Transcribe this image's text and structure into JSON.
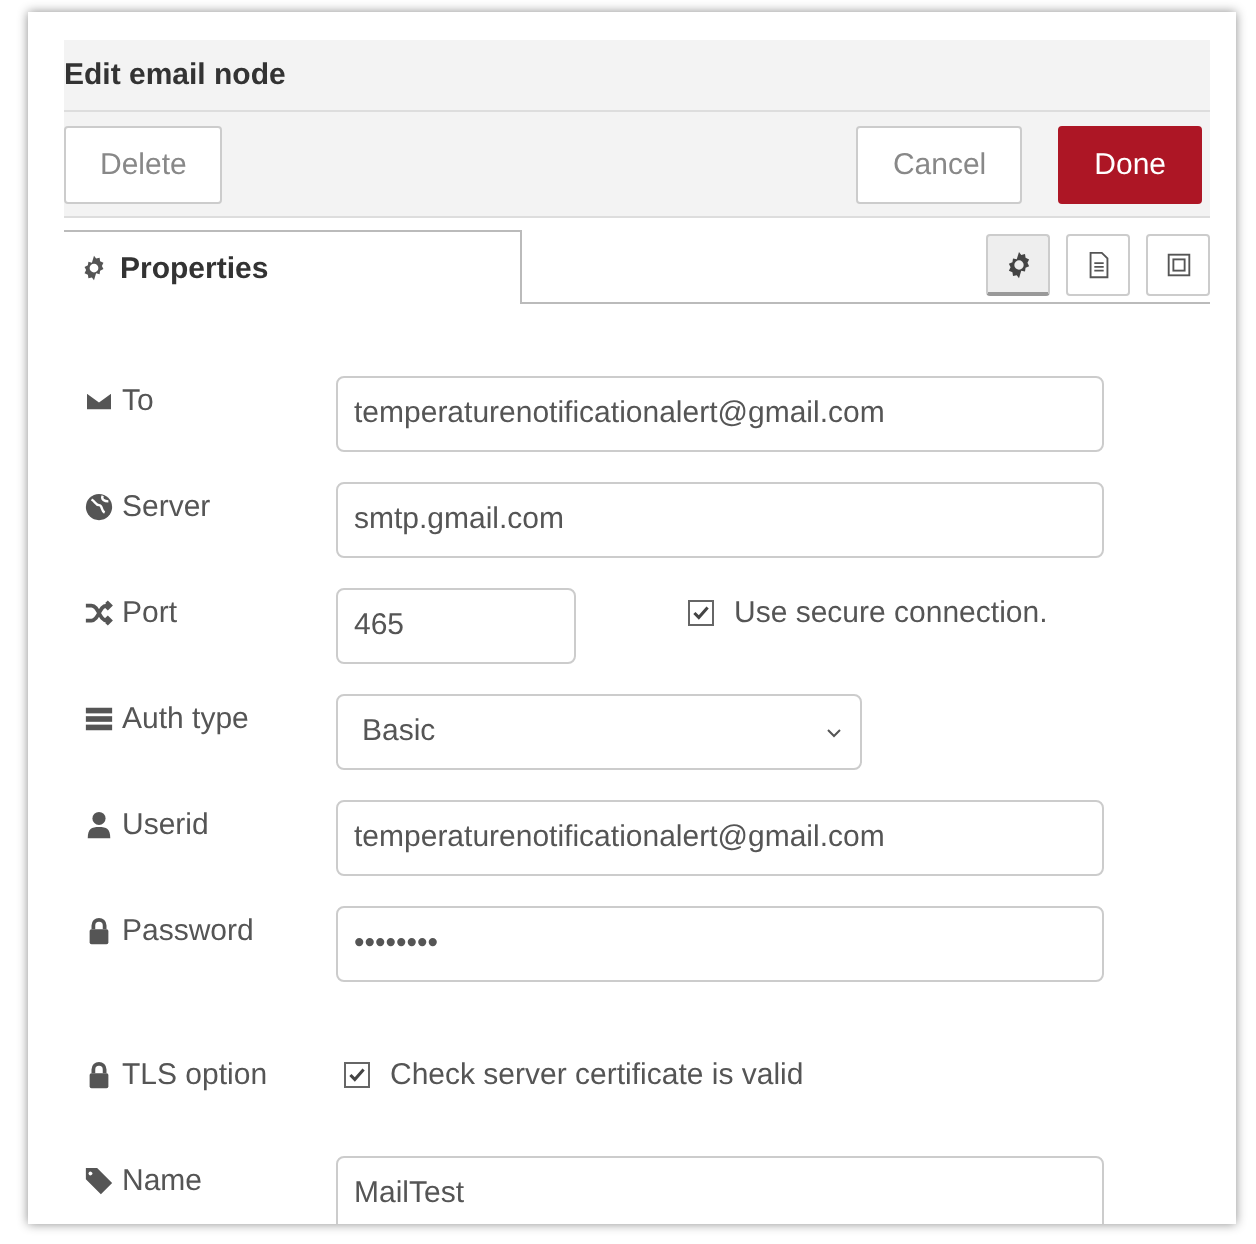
{
  "window": {
    "title": "Edit email node"
  },
  "buttons": [
    {
      "label": "Delete",
      "kind": "plain"
    },
    {
      "label": "Cancel",
      "kind": "plain"
    },
    {
      "label": "Done",
      "kind": "primary"
    }
  ],
  "tabs": [
    {
      "label": "Properties",
      "selected": true
    }
  ],
  "tab_icons": [
    {
      "kind": "gear",
      "selected": true
    },
    {
      "kind": "document",
      "selected": false
    },
    {
      "kind": "frame",
      "selected": false
    }
  ],
  "fields": [
    {
      "kind": "text",
      "label": "To",
      "value": "temperaturenotificationalert@gmail.com"
    },
    {
      "kind": "text",
      "label": "Server",
      "value": "smtp.gmail.com"
    },
    {
      "kind": "port",
      "label": "Port",
      "value": "465",
      "option": {
        "label": "Use secure connection.",
        "checked": true
      }
    },
    {
      "kind": "select",
      "label": "Auth type",
      "value": "Basic"
    },
    {
      "kind": "text",
      "label": "Userid",
      "value": "temperaturenotificationalert@gmail.com"
    },
    {
      "kind": "text",
      "label": "Password",
      "value": "••••••••"
    },
    {
      "kind": "checkbox",
      "label": "TLS option",
      "option": {
        "label": "Check server certificate is valid",
        "checked": true
      }
    },
    {
      "kind": "text",
      "label": "Name",
      "value": "MailTest"
    }
  ]
}
